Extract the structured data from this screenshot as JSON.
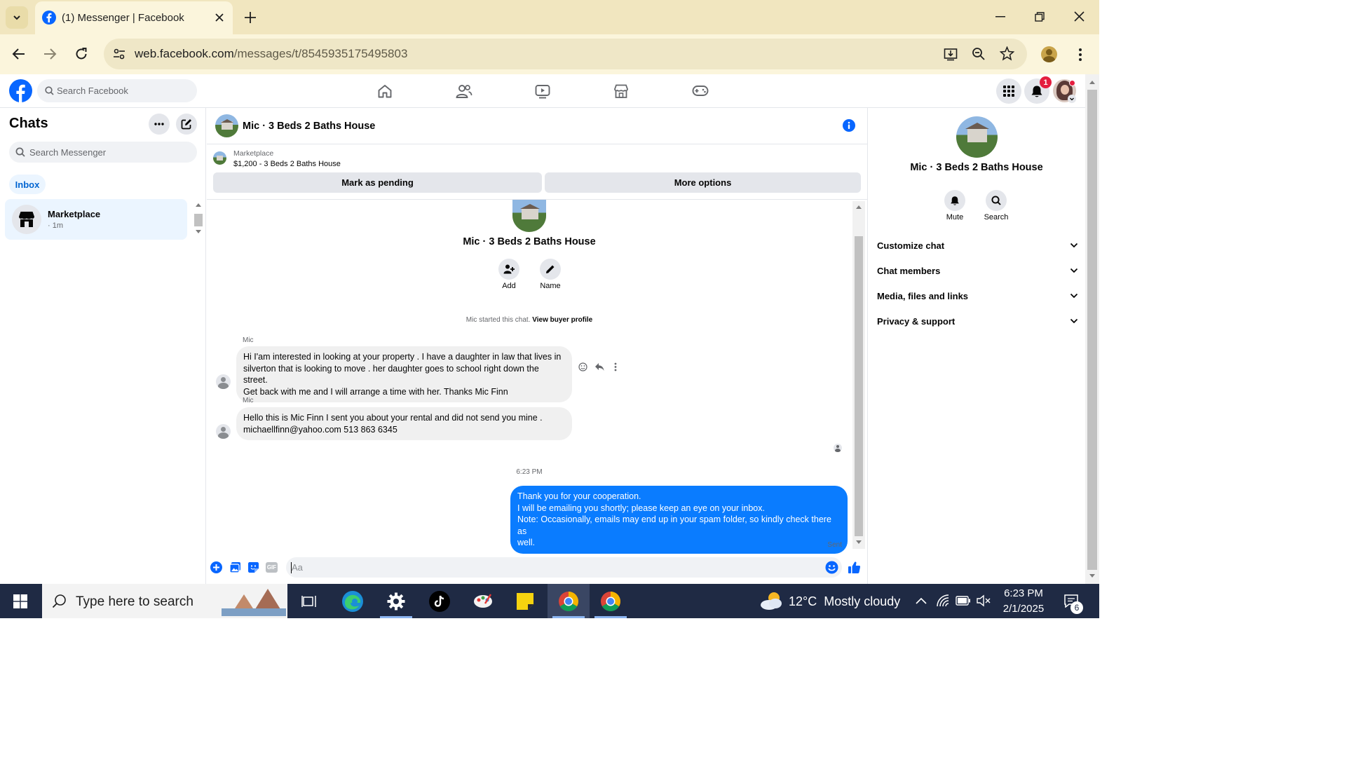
{
  "browser": {
    "tab_title": "(1) Messenger | Facebook",
    "url_domain": "web.facebook.com",
    "url_path": "/messages/t/8545935175495803"
  },
  "fb": {
    "search_placeholder": "Search Facebook",
    "notification_count": "1"
  },
  "left": {
    "title": "Chats",
    "search_placeholder": "Search Messenger",
    "inbox_label": "Inbox",
    "chat_item": {
      "name": "Marketplace",
      "time": "· 1m"
    }
  },
  "conversation": {
    "title": "Mic · 3 Beds 2 Baths House",
    "listing_source": "Marketplace",
    "listing_line": "$1,200 - 3 Beds 2 Baths House",
    "mark_pending": "Mark as pending",
    "more_options": "More options",
    "intro_name": "Mic · 3 Beds 2 Baths House",
    "add_label": "Add",
    "name_label": "Name",
    "started_text": "Mic started this chat.",
    "view_profile": "View buyer profile",
    "messages": [
      {
        "sender": "Mic",
        "lines": [
          "Hi I'am  interested in looking at your property . I have a daughter in law that lives in",
          "silverton that is looking to move . her daughter goes to school right down the street.",
          "Get back with me and I will arrange a time with her. Thanks Mic  Finn"
        ]
      },
      {
        "sender": "Mic",
        "lines": [
          "Hello this is Mic Finn I sent you about your rental and did not send you mine .",
          "michaellfinn@yahoo.com 513 863 6345"
        ]
      }
    ],
    "timestamp": "6:23 PM",
    "outgoing": {
      "lines": [
        "Thank you for your cooperation.",
        "I will be emailing you shortly; please keep an eye on your inbox.",
        "Note: Occasionally, emails may end up in your spam folder, so kindly check there as",
        "well."
      ],
      "status": "Sent"
    },
    "composer_placeholder": "Aa"
  },
  "right": {
    "name": "Mic · 3 Beds 2 Baths House",
    "mute_label": "Mute",
    "search_label": "Search",
    "sections": [
      "Customize chat",
      "Chat members",
      "Media, files and links",
      "Privacy & support"
    ]
  },
  "taskbar": {
    "search_placeholder": "Type here to search",
    "weather": "12°C  Mostly cloudy",
    "time": "6:23 PM",
    "date": "2/1/2025",
    "notif_count": "6"
  },
  "colors": {
    "messenger_blue": "#0a7cff",
    "facebook_blue": "#0866ff",
    "notification_red": "#e41e3f",
    "chrome_tab_bar": "#f1e6bf"
  }
}
